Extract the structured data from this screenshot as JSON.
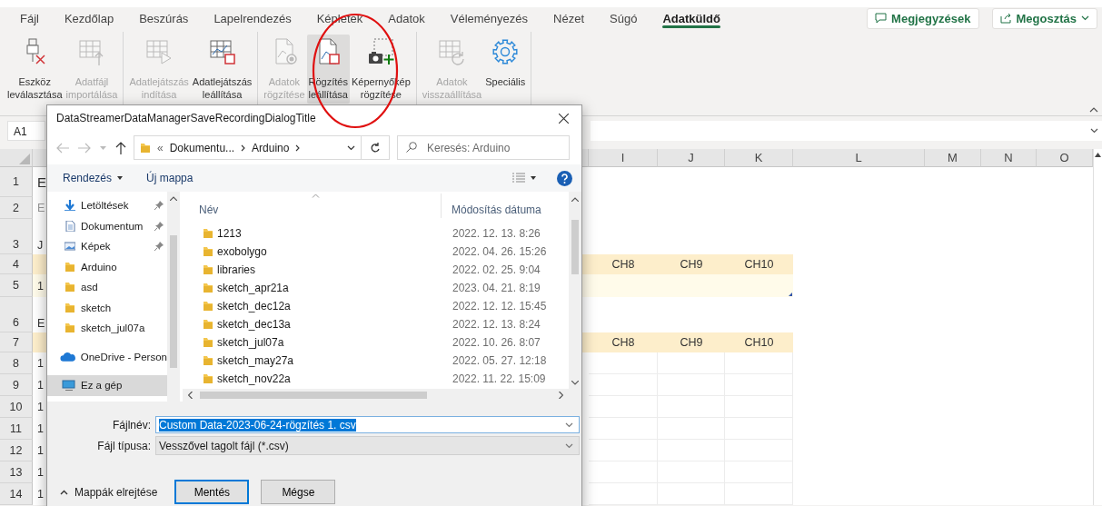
{
  "tabs": [
    {
      "label": "Fájl",
      "selected": false
    },
    {
      "label": "Kezdőlap",
      "selected": false
    },
    {
      "label": "Beszúrás",
      "selected": false
    },
    {
      "label": "Lapelrendezés",
      "selected": false
    },
    {
      "label": "Képletek",
      "selected": false
    },
    {
      "label": "Adatok",
      "selected": false
    },
    {
      "label": "Véleményezés",
      "selected": false
    },
    {
      "label": "Nézet",
      "selected": false
    },
    {
      "label": "Súgó",
      "selected": false
    },
    {
      "label": "Adatküldő",
      "selected": true
    }
  ],
  "header_buttons": [
    {
      "kind": "comments",
      "label": "Megjegyzések"
    },
    {
      "kind": "share",
      "label": "Megosztás"
    }
  ],
  "ribbon": {
    "groups": [
      {
        "buttons": [
          {
            "kind": "disconnect",
            "lines": [
              "Eszköz",
              "leválasztása"
            ],
            "disabled": false,
            "highlighted": false
          },
          {
            "kind": "import",
            "lines": [
              "Adatfájl",
              "importálása"
            ],
            "disabled": true,
            "highlighted": false
          }
        ]
      },
      {
        "buttons": [
          {
            "kind": "play",
            "lines": [
              "Adatlejátszás",
              "indítása"
            ],
            "disabled": true,
            "highlighted": false
          },
          {
            "kind": "stop_playback",
            "lines": [
              "Adatlejátszás",
              "leállítása"
            ],
            "disabled": false,
            "highlighted": false
          }
        ]
      },
      {
        "buttons": [
          {
            "kind": "record",
            "lines": [
              "Adatok",
              "rögzítése"
            ],
            "disabled": true,
            "highlighted": false
          },
          {
            "kind": "stop_recording",
            "lines": [
              "Rögzítés",
              "leállítása"
            ],
            "disabled": false,
            "highlighted": true
          },
          {
            "kind": "screenshot",
            "lines": [
              "Képernyőkép",
              "rögzítése"
            ],
            "disabled": false,
            "highlighted": false
          }
        ]
      },
      {
        "buttons": [
          {
            "kind": "reset",
            "lines": [
              "Adatok",
              "visszaállítása"
            ],
            "disabled": true,
            "highlighted": false
          },
          {
            "kind": "settings",
            "lines": [
              "Speciális"
            ],
            "disabled": false,
            "highlighted": false
          }
        ]
      }
    ]
  },
  "name_box": "A1",
  "columns": [
    "I",
    "J",
    "K",
    "L",
    "M",
    "N",
    "O"
  ],
  "rows": [
    {
      "number": "1",
      "kind": "title",
      "first_cell": "E"
    },
    {
      "number": "2",
      "kind": "note",
      "first_cell": "E"
    },
    {
      "number": "3",
      "kind": "section",
      "first_cell": "J"
    },
    {
      "number": "4",
      "kind": "header",
      "cells": [
        "CH8",
        "CH9",
        "CH10"
      ]
    },
    {
      "number": "5",
      "kind": "input",
      "first_cell": "1"
    },
    {
      "number": "6",
      "kind": "section",
      "first_cell": "E"
    },
    {
      "number": "7",
      "kind": "header",
      "cells": [
        "CH8",
        "CH9",
        "CH10"
      ]
    },
    {
      "number": "8",
      "kind": "data",
      "first_cell": "1"
    },
    {
      "number": "9",
      "kind": "data",
      "first_cell": "1"
    },
    {
      "number": "10",
      "kind": "data",
      "first_cell": "1"
    },
    {
      "number": "11",
      "kind": "data",
      "first_cell": "1"
    },
    {
      "number": "12",
      "kind": "data",
      "first_cell": "1"
    },
    {
      "number": "13",
      "kind": "data",
      "first_cell": "1"
    },
    {
      "number": "14",
      "kind": "data",
      "first_cell": "1"
    }
  ],
  "dialog": {
    "title": "DataStreamerDataManagerSaveRecordingDialogTitle",
    "address": {
      "overflow": "«",
      "path": [
        "Dokumentu...",
        "Arduino"
      ]
    },
    "search": {
      "placeholder": "Keresés: Arduino"
    },
    "toolbar": {
      "organize": "Rendezés",
      "new_folder": "Új mappa"
    },
    "sidebar": [
      {
        "items": [
          {
            "kind": "download",
            "label": "Letöltések",
            "pinned": true,
            "selected": false
          },
          {
            "kind": "document",
            "label": "Dokumentum",
            "pinned": true,
            "selected": false
          },
          {
            "kind": "pictures",
            "label": "Képek",
            "pinned": true,
            "selected": false
          },
          {
            "kind": "folder",
            "label": "Arduino",
            "pinned": false,
            "selected": false
          },
          {
            "kind": "folder",
            "label": "asd",
            "pinned": false,
            "selected": false
          },
          {
            "kind": "folder",
            "label": "sketch",
            "pinned": false,
            "selected": false
          },
          {
            "kind": "folder",
            "label": "sketch_jul07a",
            "pinned": false,
            "selected": false
          }
        ]
      },
      {
        "items": [
          {
            "kind": "cloud",
            "label": "OneDrive - Person",
            "pinned": false,
            "selected": false
          }
        ]
      },
      {
        "items": [
          {
            "kind": "computer",
            "label": "Ez a gép",
            "pinned": false,
            "selected": true
          }
        ]
      }
    ],
    "list": {
      "columns": [
        "Név",
        "Módosítás dátuma"
      ],
      "rows": [
        {
          "name": "1213",
          "date": "2022. 12. 13. 8:26"
        },
        {
          "name": "exobolygo",
          "date": "2022. 04. 26. 15:26"
        },
        {
          "name": "libraries",
          "date": "2022. 02. 25. 9:04"
        },
        {
          "name": "sketch_apr21a",
          "date": "2023. 04. 21. 8:19"
        },
        {
          "name": "sketch_dec12a",
          "date": "2022. 12. 12. 15:45"
        },
        {
          "name": "sketch_dec13a",
          "date": "2022. 12. 13. 8:24"
        },
        {
          "name": "sketch_jul07a",
          "date": "2022. 10. 26. 8:07"
        },
        {
          "name": "sketch_may27a",
          "date": "2022. 05. 27. 12:18"
        },
        {
          "name": "sketch_nov22a",
          "date": "2022. 11. 22. 15:09"
        }
      ]
    },
    "file_name": {
      "label": "Fájlnév:",
      "value": "Custom Data-2023-06-24-rögzítés 1. csv",
      "text_selected": true
    },
    "file_type": {
      "label": "Fájl típusa:",
      "value": "Vesszővel tagolt fájl (*.csv)"
    },
    "hide_folders": "Mappák elrejtése",
    "buttons": [
      {
        "label": "Mentés",
        "default": true
      },
      {
        "label": "Mégse",
        "default": false
      }
    ]
  },
  "annotation": {
    "kind": "ellipse"
  }
}
